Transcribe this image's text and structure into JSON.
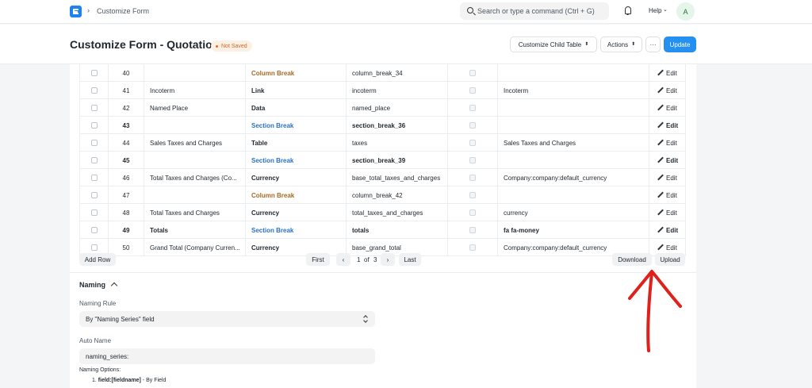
{
  "navbar": {
    "breadcrumb": "Customize Form",
    "search_placeholder": "Search or type a command (Ctrl + G)",
    "help_label": "Help",
    "avatar_initial": "A"
  },
  "page": {
    "title": "Customize Form - Quotation",
    "status": "Not Saved",
    "actions": {
      "child_table": "Customize Child Table",
      "actions": "Actions",
      "more": "···",
      "update": "Update"
    }
  },
  "table": {
    "rows": [
      {
        "num": "40",
        "label": "",
        "type": "Column Break",
        "fieldname": "column_break_34",
        "options": "",
        "edit": "Edit"
      },
      {
        "num": "41",
        "label": "Incoterm",
        "type": "Link",
        "fieldname": "incoterm",
        "options": "Incoterm",
        "edit": "Edit"
      },
      {
        "num": "42",
        "label": "Named Place",
        "type": "Data",
        "fieldname": "named_place",
        "options": "",
        "edit": "Edit"
      },
      {
        "num": "43",
        "label": "",
        "type": "Section Break",
        "fieldname": "section_break_36",
        "options": "",
        "edit": "Edit"
      },
      {
        "num": "44",
        "label": "Sales Taxes and Charges",
        "type": "Table",
        "fieldname": "taxes",
        "options": "Sales Taxes and Charges",
        "edit": "Edit"
      },
      {
        "num": "45",
        "label": "",
        "type": "Section Break",
        "fieldname": "section_break_39",
        "options": "",
        "edit": "Edit"
      },
      {
        "num": "46",
        "label": "Total Taxes and Charges (Co...",
        "type": "Currency",
        "fieldname": "base_total_taxes_and_charges",
        "options": "Company:company:default_currency",
        "edit": "Edit"
      },
      {
        "num": "47",
        "label": "",
        "type": "Column Break",
        "fieldname": "column_break_42",
        "options": "",
        "edit": "Edit"
      },
      {
        "num": "48",
        "label": "Total Taxes and Charges",
        "type": "Currency",
        "fieldname": "total_taxes_and_charges",
        "options": "currency",
        "edit": "Edit"
      },
      {
        "num": "49",
        "label": "Totals",
        "type": "Section Break",
        "fieldname": "totals",
        "options": "fa fa-money",
        "edit": "Edit"
      },
      {
        "num": "50",
        "label": "Grand Total (Company Curren...",
        "type": "Currency",
        "fieldname": "base_grand_total",
        "options": "Company:company:default_currency",
        "edit": "Edit"
      }
    ],
    "add_row": "Add Row",
    "pager": {
      "first": "First",
      "prev": "‹",
      "current": "1",
      "of": "of",
      "total": "3",
      "next": "›",
      "last": "Last"
    },
    "download": "Download",
    "upload": "Upload"
  },
  "naming": {
    "section_title": "Naming",
    "rule_label": "Naming Rule",
    "rule_value": "By \"Naming Series\" field",
    "auto_name_label": "Auto Name",
    "auto_name_value": "naming_series:",
    "options_label": "Naming Options:",
    "option_1_code": "field:[fieldname]",
    "option_1_desc": " - By Field"
  },
  "annotation": {
    "color": "#e0201b"
  }
}
